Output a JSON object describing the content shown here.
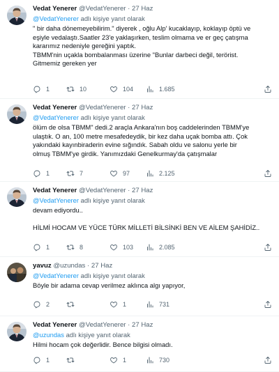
{
  "tweets": [
    {
      "name": "Vedat Yenerer",
      "handle": "@VedatYenerer",
      "date": "27 Haz",
      "reply_mention": "@VedatYenerer",
      "reply_suffix": " adlı kişiye yanıt olarak",
      "body": [
        "\" bir daha dönemeyebilirim.\" diyerek , oğlu Alp' kucaklayıp, koklayıp öptü ve",
        "eşiyle vedalaştı.Saatler 23'e yaklaşırken, teslim olmama ve er geç çatışma",
        "kararımız nedeniyle gereğini yaptık.",
        "TBMM'nin uçakla bombalanması üzerine \"Bunlar darbeci değil, terörist.",
        "Gitmemiz gereken yer"
      ],
      "replies": "1",
      "retweets": "10",
      "likes": "104",
      "views": "1.685"
    },
    {
      "name": "Vedat Yenerer",
      "handle": "@VedatYenerer",
      "date": "27 Haz",
      "reply_mention": "@VedatYenerer",
      "reply_suffix": " adlı kişiye yanıt olarak",
      "body": [
        "ölüm de olsa TBMM\" dedi.2 araçla Ankara'nın boş caddelerinden TBMM'ye",
        "ulaştık. O an, 100 metre mesafedeydik, bir kez daha uçak bomba attı. Çok",
        "yakındaki kayınbiraderin evine sığındık. Sabah oldu ve salonu yerle bir",
        "olmuş TBMM'ye girdik. Yanımızdaki Genelkurmay'da çatışmalar"
      ],
      "replies": "1",
      "retweets": "7",
      "likes": "97",
      "views": "2.125"
    },
    {
      "name": "Vedat Yenerer",
      "handle": "@VedatYenerer",
      "date": "27 Haz",
      "reply_mention": "@VedatYenerer",
      "reply_suffix": " adlı kişiye yanıt olarak",
      "body": [
        "devam ediyordu..",
        "",
        "HİLMİ HOCAM VE YÜCE TÜRK MİLLETİ BİLSİNKİ BEN VE AİLEM ŞAHİDİZ.."
      ],
      "replies": "1",
      "retweets": "8",
      "likes": "103",
      "views": "2.085"
    },
    {
      "name": "yavuz",
      "handle": "@uzundas",
      "date": "27 Haz",
      "reply_mention": "@VedatYenerer",
      "reply_suffix": " adlı kişiye yanıt olarak",
      "body": [
        "Böyle bir adama cevap verilmez aklınca algı yapıyor,"
      ],
      "replies": "2",
      "retweets": "",
      "likes": "1",
      "views": "731"
    },
    {
      "name": "Vedat Yenerer",
      "handle": "@VedatYenerer",
      "date": "27 Haz",
      "reply_mention": "@uzundas",
      "reply_suffix": " adlı kişiye yanıt olarak",
      "body": [
        "Hilmi hocam çok değerlidir. Bence bilgisi olmadı."
      ],
      "replies": "1",
      "retweets": "",
      "likes": "1",
      "views": "730"
    }
  ],
  "separator": "·",
  "colors": {
    "accent": "#1d9bf0",
    "secondary_text": "#536471",
    "primary_text": "#0f1419",
    "divider": "#eff3f4"
  },
  "icons": [
    "reply-icon",
    "retweet-icon",
    "like-icon",
    "views-icon",
    "share-icon"
  ]
}
